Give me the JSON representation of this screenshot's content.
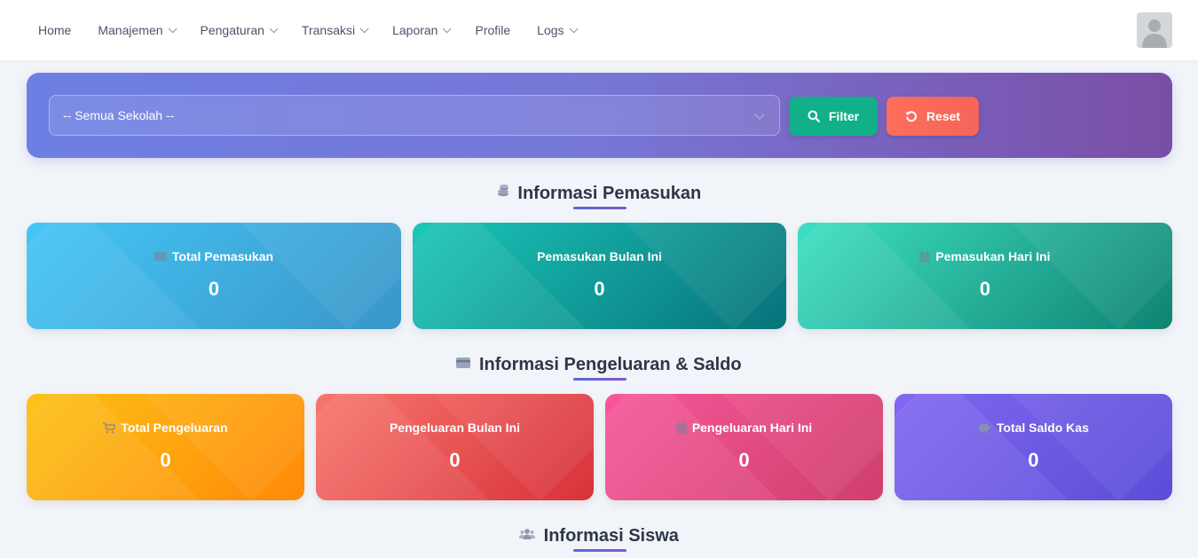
{
  "nav": {
    "items": [
      {
        "label": "Home",
        "dropdown": false
      },
      {
        "label": "Manajemen",
        "dropdown": true
      },
      {
        "label": "Pengaturan",
        "dropdown": true
      },
      {
        "label": "Transaksi",
        "dropdown": true
      },
      {
        "label": "Laporan",
        "dropdown": true
      },
      {
        "label": "Profile",
        "dropdown": false
      },
      {
        "label": "Logs",
        "dropdown": true
      }
    ]
  },
  "filter": {
    "school_select": "-- Semua Sekolah --",
    "filter_label": "Filter",
    "reset_label": "Reset"
  },
  "pemasukan": {
    "title": "Informasi Pemasukan",
    "cards": [
      {
        "label": "Total Pemasukan",
        "value": "0",
        "icon": "wallet-icon"
      },
      {
        "label": "Pemasukan Bulan Ini",
        "value": "0",
        "icon": ""
      },
      {
        "label": "Pemasukan Hari Ini",
        "value": "0",
        "icon": "calendar-icon"
      }
    ]
  },
  "pengeluaran": {
    "title": "Informasi Pengeluaran & Saldo",
    "cards": [
      {
        "label": "Total Pengeluaran",
        "value": "0",
        "icon": "cart-icon"
      },
      {
        "label": "Pengeluaran Bulan Ini",
        "value": "0",
        "icon": ""
      },
      {
        "label": "Pengeluaran Hari Ini",
        "value": "0",
        "icon": "calendar-icon"
      },
      {
        "label": "Total Saldo Kas",
        "value": "0",
        "icon": "piggy-bank-icon"
      }
    ]
  },
  "siswa": {
    "title": "Informasi Siswa"
  },
  "colors": {
    "accent": "#5a67d8",
    "filter_button": "#12b089",
    "reset_button": "#f4655a"
  }
}
